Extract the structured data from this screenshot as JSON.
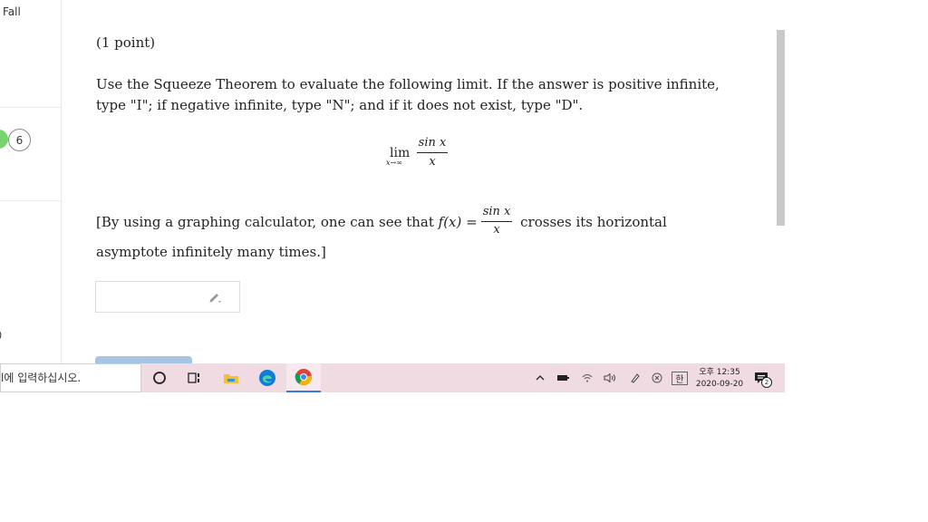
{
  "sidebar": {
    "term_label": "Fall",
    "badge_count": "6",
    "partial_label": ")"
  },
  "problem": {
    "points": "(1 point)",
    "instruction": "Use the Squeeze Theorem to evaluate the following limit. If the answer is positive infinite, type \"I\"; if negative infinite, type \"N\"; and if it does not exist, type \"D\".",
    "limit": {
      "operator": "lim",
      "subscript": "x→∞",
      "numerator": "sin x",
      "denominator": "x"
    },
    "hint_before": "[By using a graphing calculator, one can see that ",
    "hint_function": "f(x) =",
    "hint_numerator": "sin x",
    "hint_denominator": "x",
    "hint_after": " crosses its horizontal asymptote infinitely many times.]",
    "answer_value": ""
  },
  "taskbar": {
    "search_text": "l에 입력하십시오.",
    "clock_time": "오후 12:35",
    "clock_date": "2020-09-20",
    "ime_label": "한",
    "notification_count": "2"
  },
  "colors": {
    "taskbar_bg": "#f0dbe3",
    "edge_blue": "#0f7dd6",
    "chrome_red": "#db4437",
    "chrome_yellow": "#f4b400",
    "chrome_green": "#0f9d58",
    "folder_yellow": "#f2c02e",
    "badge_green": "#79d36f"
  },
  "icons": [
    "cortana-icon",
    "task-view-icon",
    "file-explorer-icon",
    "edge-icon",
    "chrome-icon",
    "pencil-icon",
    "chevron-up-icon",
    "battery-icon",
    "wifi-icon",
    "volume-icon",
    "pen-icon",
    "close-circle-icon",
    "notification-icon"
  ]
}
